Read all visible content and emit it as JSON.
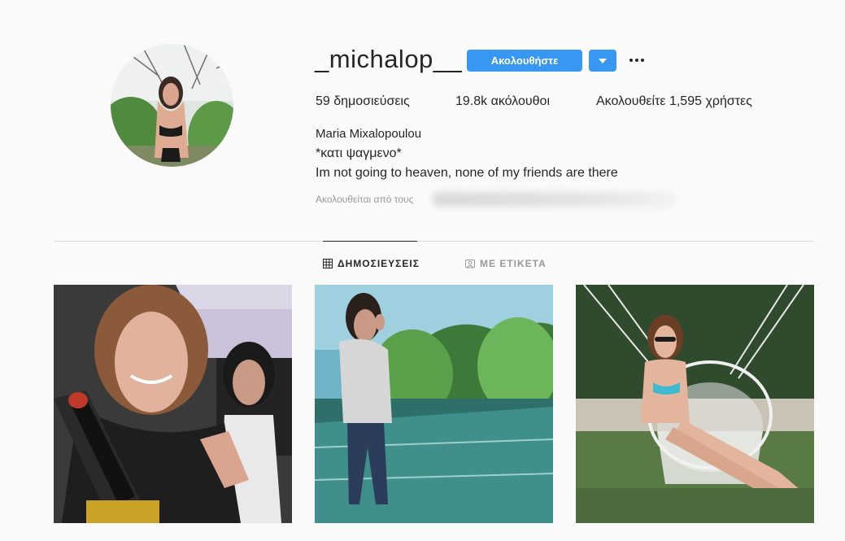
{
  "profile": {
    "username": "_michalop__",
    "follow_label": "Ακολουθήστε",
    "stats": {
      "posts": "59 δημοσιεύσεις",
      "followers": "19.8k ακόλουθοι",
      "following": "Ακολουθείτε 1,595 χρήστες"
    },
    "full_name": "Maria Mixalopoulou",
    "bio_line1": "*κατι ψαγμενο*",
    "bio_line2": "Im not going to heaven, none of my friends are there",
    "followed_by_prefix": "Ακολουθείται από τους"
  },
  "tabs": [
    {
      "label": "ΔΗΜΟΣΙΕΥΣΕΙΣ",
      "icon": "grid-icon",
      "active": true
    },
    {
      "label": "ΜΕ ΕΤΙΚΕΤΑ",
      "icon": "tag-icon",
      "active": false
    }
  ],
  "colors": {
    "accent": "#3897f0",
    "text": "#262626",
    "muted": "#999999",
    "background": "#fafafa"
  },
  "posts": [
    {
      "description_icon": "photo-selfie-car"
    },
    {
      "description_icon": "photo-lake-standing"
    },
    {
      "description_icon": "photo-swing-chair"
    }
  ]
}
